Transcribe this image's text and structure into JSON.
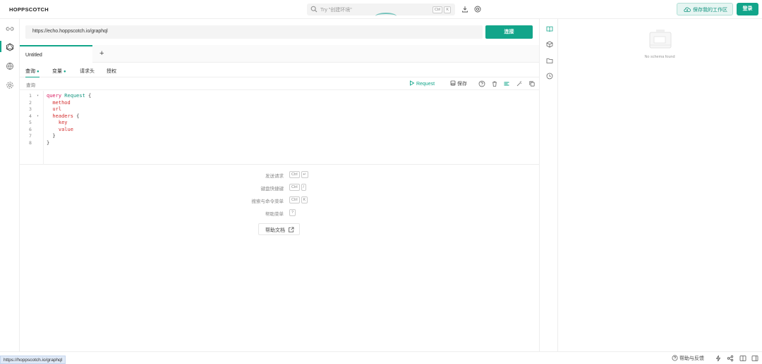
{
  "header": {
    "brand": "HOPPSCOTCH",
    "search_placeholder": "Try \"创建环境\"",
    "search_kbd1": "Ctrl",
    "search_kbd2": "K",
    "save_workspace": "保存我的工作区",
    "login": "登录"
  },
  "request": {
    "url": "https://echo.hoppscotch.io/graphql",
    "connect": "连接"
  },
  "tabs": [
    {
      "label": "Untitled"
    }
  ],
  "add_tab": "+",
  "subtabs": {
    "query": "查询",
    "variables": "变量",
    "headers": "请求头",
    "auth": "授权"
  },
  "query_bar": {
    "label": "查询",
    "request": "Request",
    "save": "保存"
  },
  "editor": {
    "line_numbers": [
      "1",
      "2",
      "3",
      "4",
      "5",
      "6",
      "7",
      "8"
    ]
  },
  "shortcuts": [
    {
      "label": "发送请求",
      "keys": [
        "Ctrl",
        "↵"
      ]
    },
    {
      "label": "键盘快捷键",
      "keys": [
        "Ctrl",
        "/"
      ]
    },
    {
      "label": "搜索与命令菜单",
      "keys": [
        "Ctrl",
        "K"
      ]
    },
    {
      "label": "帮助菜单",
      "keys": [
        "?"
      ]
    }
  ],
  "docs_button": "帮助文档",
  "schema": {
    "empty": "No schema found"
  },
  "footer": {
    "status_url": "https://hoppscotch.io/graphql",
    "help": "帮助与反馈"
  },
  "colors": {
    "accent": "#12a58a"
  }
}
